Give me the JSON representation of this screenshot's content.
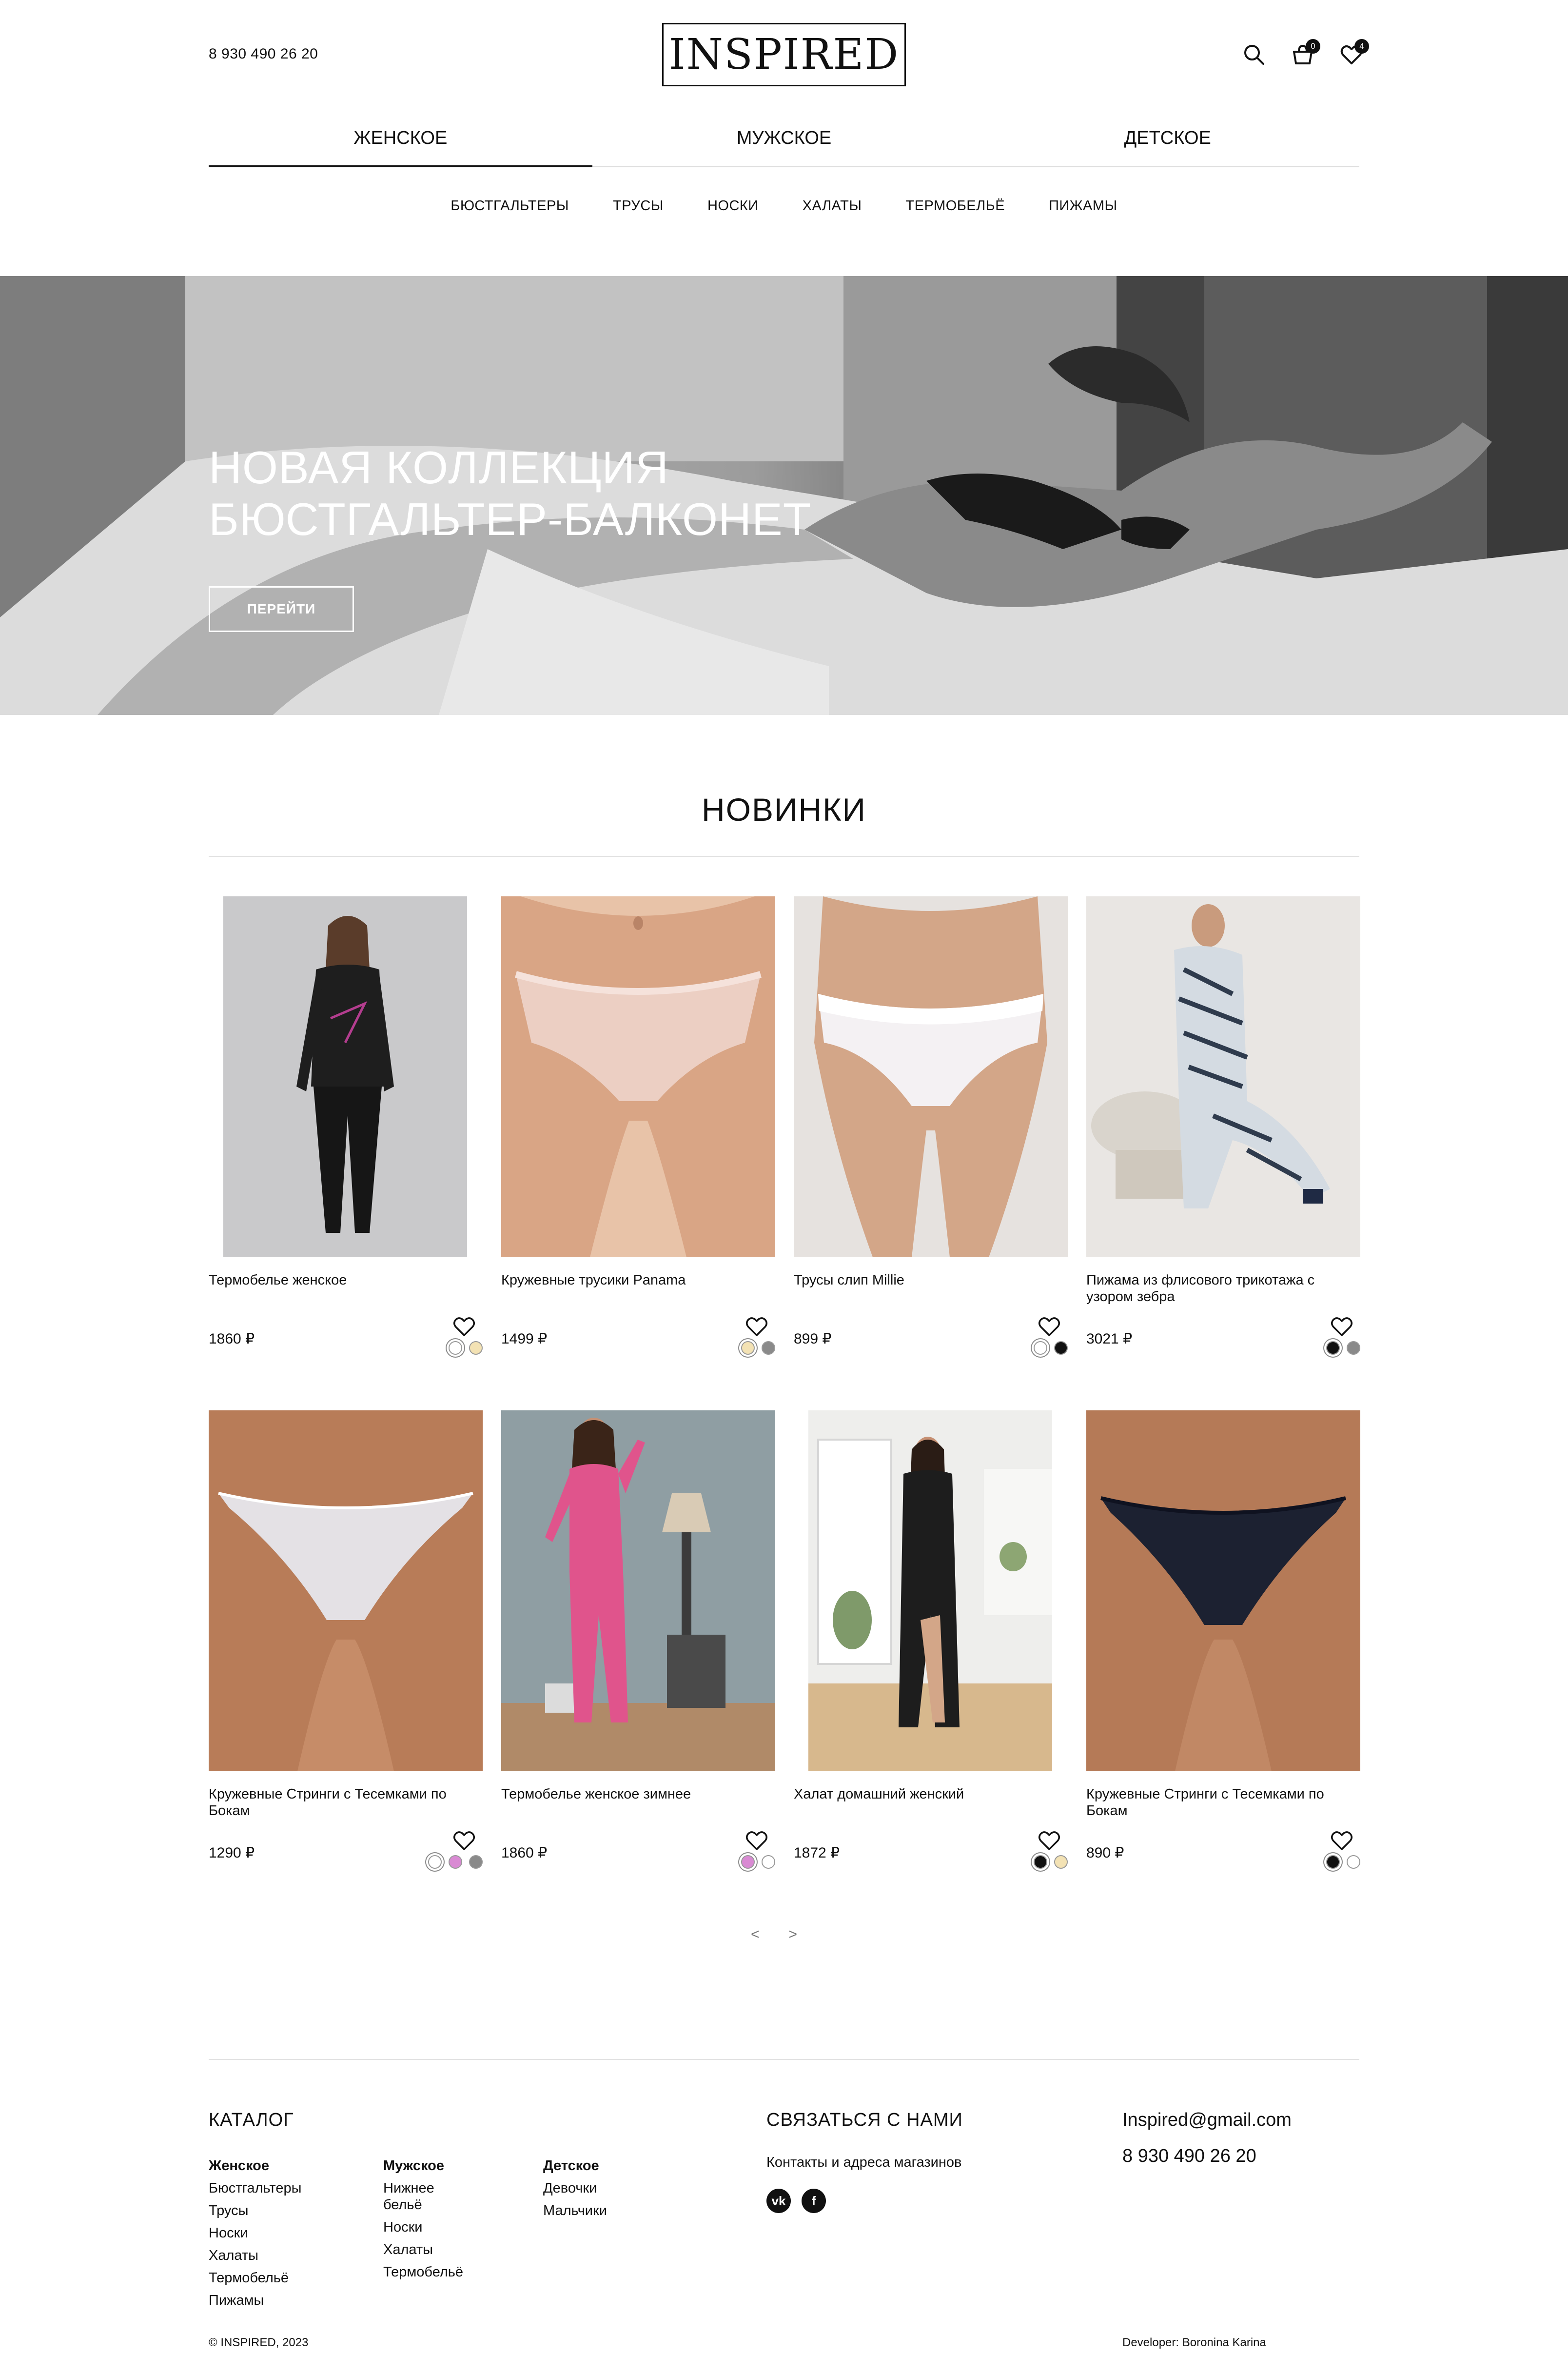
{
  "header": {
    "phone": "8 930 490 26 20",
    "logo": "INSPIRED",
    "cart_count": "0",
    "fav_count": "4",
    "gender_tabs": [
      {
        "label": "ЖЕНСКОЕ",
        "active": true
      },
      {
        "label": "МУЖСКОЕ",
        "active": false
      },
      {
        "label": "ДЕТСКОЕ",
        "active": false
      }
    ],
    "categories": [
      "БЮСТГАЛЬТЕРЫ",
      "ТРУСЫ",
      "НОСКИ",
      "ХАЛАТЫ",
      "ТЕРМОБЕЛЬЁ",
      "ПИЖАМЫ"
    ]
  },
  "hero": {
    "title_line1": "НОВАЯ КОЛЛЕКЦИЯ",
    "title_line2": "БЮСТГАЛЬТЕР-БАЛКОНЕТ",
    "button": "ПЕРЕЙТИ"
  },
  "new_section": {
    "title": "НОВИНКИ",
    "products": [
      {
        "name": "Термобелье женское",
        "price": "1860 ₽",
        "swatches": [
          "#ffffff",
          "#f3e2b4"
        ],
        "selected": 0
      },
      {
        "name": "Кружевные трусики Panama",
        "price": "1499 ₽",
        "swatches": [
          "#f3e2b4",
          "#8a8a8a"
        ],
        "selected": 0
      },
      {
        "name": "Трусы слип Millie",
        "price": "899 ₽",
        "swatches": [
          "#ffffff",
          "#111111"
        ],
        "selected": 0
      },
      {
        "name": "Пижама из флисового трикотажа с узором зебра",
        "price": "3021 ₽",
        "swatches": [
          "#111111",
          "#8a8a8a"
        ],
        "selected": 0
      },
      {
        "name": "Кружевные Стринги с Тесемками по Бокам",
        "price": "1290 ₽",
        "swatches": [
          "#ffffff",
          "#d98ad3",
          "#8a8a8a"
        ],
        "selected": 0
      },
      {
        "name": "Термобелье женское зимнее",
        "price": "1860 ₽",
        "swatches": [
          "#d98ad3",
          "#ffffff"
        ],
        "selected": 0
      },
      {
        "name": "Халат домашний женский",
        "price": "1872 ₽",
        "swatches": [
          "#111111",
          "#f3e2b4"
        ],
        "selected": 0
      },
      {
        "name": "Кружевные Стринги с Тесемками по Бокам",
        "price": "890 ₽",
        "swatches": [
          "#111111",
          "#ffffff"
        ],
        "selected": 0
      }
    ],
    "pager_prev": "<",
    "pager_next": ">"
  },
  "footer": {
    "catalog_title": "КАТАЛОГ",
    "columns": [
      {
        "title": "Женское",
        "items": [
          "Бюстгальтеры",
          "Трусы",
          "Носки",
          "Халаты",
          "Термобельё",
          "Пижамы"
        ]
      },
      {
        "title": "Мужское",
        "items": [
          "Нижнее бельё",
          "Носки",
          "Халаты",
          "Термобельё"
        ]
      },
      {
        "title": "Детское",
        "items": [
          "Девочки",
          "Мальчики"
        ]
      }
    ],
    "contact_title": "СВЯЗАТЬСЯ С НАМИ",
    "contacts_link": "Контакты и адреса магазинов",
    "social": [
      "vk-icon",
      "facebook-icon"
    ],
    "email": "Inspired@gmail.com",
    "phone": "8 930 490 26 20",
    "copyright": "© INSPIRED, 2023",
    "developer": "Developer: Boronina Karina"
  }
}
